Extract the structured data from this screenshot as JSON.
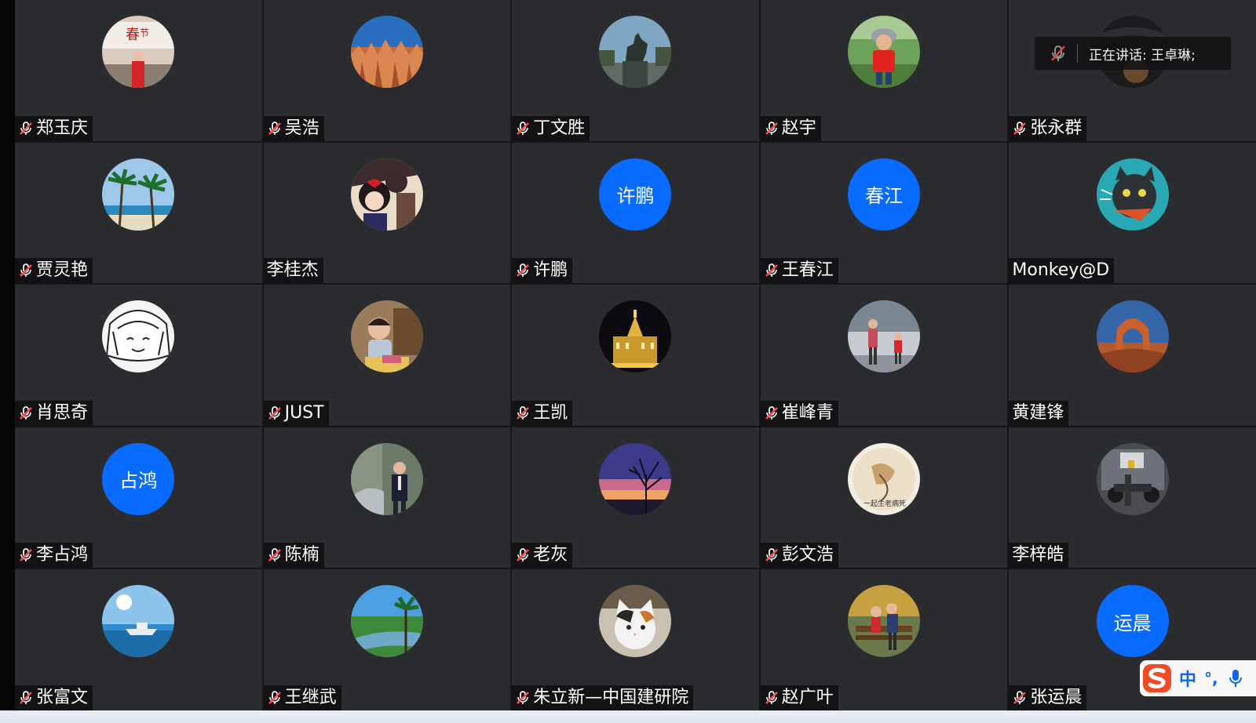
{
  "speaking": {
    "text": "正在讲话: 王卓琳;"
  },
  "ime": {
    "mode_label": "中",
    "punct_label": "°,"
  },
  "colors": {
    "tile": "#2b2c2f",
    "avatar_blue": "#0a6bff",
    "accent": "#1565e0"
  },
  "participants": [
    {
      "name": "郑玉庆",
      "muted": true,
      "avatar": "photo-banner-woman"
    },
    {
      "name": "吴浩",
      "muted": true,
      "avatar": "photo-canyon"
    },
    {
      "name": "丁文胜",
      "muted": true,
      "avatar": "photo-statue"
    },
    {
      "name": "赵宇",
      "muted": true,
      "avatar": "photo-child-park"
    },
    {
      "name": "张永群",
      "muted": true,
      "avatar": "photo-dark"
    },
    {
      "name": "贾灵艳",
      "muted": true,
      "avatar": "photo-palms"
    },
    {
      "name": "李桂杰",
      "muted": false,
      "avatar": "photo-anime-girl"
    },
    {
      "name": "许鹏",
      "muted": true,
      "avatar_text": "许鹏"
    },
    {
      "name": "王春江",
      "muted": true,
      "avatar_text": "春江"
    },
    {
      "name": "Monkey@D",
      "muted": false,
      "avatar": "photo-cartoon-cat"
    },
    {
      "name": "肖思奇",
      "muted": true,
      "avatar": "photo-sketch"
    },
    {
      "name": "JUST",
      "muted": true,
      "avatar": "photo-kid"
    },
    {
      "name": "王凯",
      "muted": true,
      "avatar": "photo-night-building"
    },
    {
      "name": "崔峰青",
      "muted": true,
      "avatar": "photo-street"
    },
    {
      "name": "黄建锋",
      "muted": false,
      "avatar": "photo-arch"
    },
    {
      "name": "李占鸿",
      "muted": true,
      "avatar_text": "占鸿"
    },
    {
      "name": "陈楠",
      "muted": true,
      "avatar": "photo-man-outdoor"
    },
    {
      "name": "老灰",
      "muted": true,
      "avatar": "photo-sunset-tree"
    },
    {
      "name": "彭文浩",
      "muted": true,
      "avatar": "photo-art-circle"
    },
    {
      "name": "李梓皓",
      "muted": false,
      "avatar": "photo-motorcycle"
    },
    {
      "name": "张富文",
      "muted": true,
      "avatar": "photo-boat-sea"
    },
    {
      "name": "王继武",
      "muted": true,
      "avatar": "photo-river"
    },
    {
      "name": "朱立新—中国建研院",
      "muted": true,
      "avatar": "photo-cat"
    },
    {
      "name": "赵广叶",
      "muted": true,
      "avatar": "photo-bench"
    },
    {
      "name": "张运晨",
      "muted": true,
      "avatar_text": "运晨"
    }
  ]
}
